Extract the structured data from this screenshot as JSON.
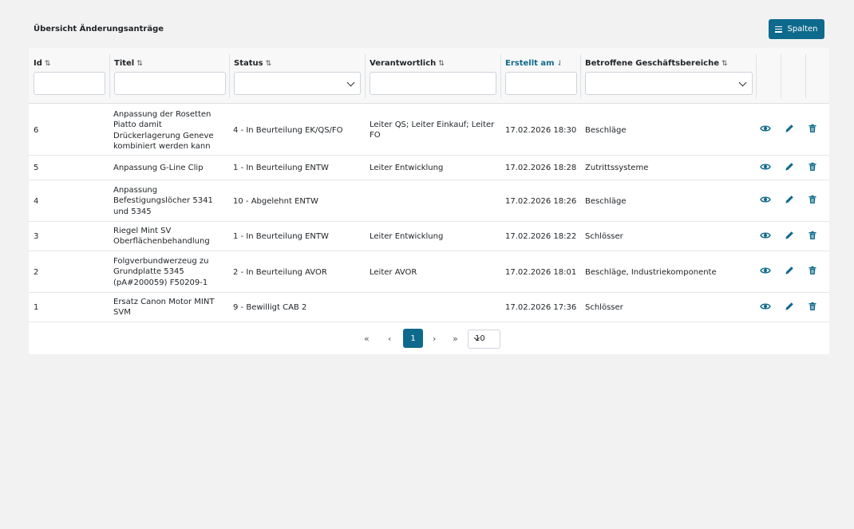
{
  "page": {
    "title": "Übersicht Änderungsanträge"
  },
  "toolbar": {
    "columns_label": "Spalten",
    "columns_icon": "menu-bars-icon"
  },
  "colors": {
    "accent": "#0e6a8c",
    "background": "#f2f2f2"
  },
  "table": {
    "headers": {
      "id": "Id",
      "titel": "Titel",
      "status": "Status",
      "verantwortlich": "Verantwortlich",
      "erstellt": "Erstellt am",
      "bereiche": "Betroffene Geschäftsbereiche"
    },
    "sort_icons": {
      "default": "⇅",
      "active": "⇃"
    },
    "sorted_column": "erstellt",
    "rows": [
      {
        "id": "6",
        "titel": "Anpassung der Rosetten Piatto damit Drückerlagerung Geneve kombiniert werden kann",
        "status": "4 - In Beurteilung EK/QS/FO",
        "verantwortlich": "Leiter QS; Leiter Einkauf; Leiter FO",
        "erstellt": "17.02.2026 18:30",
        "bereiche": "Beschläge"
      },
      {
        "id": "5",
        "titel": "Anpassung G-Line Clip",
        "status": "1 - In Beurteilung ENTW",
        "verantwortlich": "Leiter Entwicklung",
        "erstellt": "17.02.2026 18:28",
        "bereiche": "Zutrittssysteme"
      },
      {
        "id": "4",
        "titel": "Anpassung Befestigungslöcher 5341 und 5345",
        "status": "10 - Abgelehnt ENTW",
        "verantwortlich": "",
        "erstellt": "17.02.2026 18:26",
        "bereiche": "Beschläge"
      },
      {
        "id": "3",
        "titel": "Riegel Mint SV Oberflächenbehandlung",
        "status": "1 - In Beurteilung ENTW",
        "verantwortlich": "Leiter Entwicklung",
        "erstellt": "17.02.2026 18:22",
        "bereiche": "Schlösser"
      },
      {
        "id": "2",
        "titel": "Folgverbundwerzeug zu Grundplatte 5345 (pA#200059) F50209-1",
        "status": "2 - In Beurteilung AVOR",
        "verantwortlich": "Leiter AVOR",
        "erstellt": "17.02.2026 18:01",
        "bereiche": "Beschläge, Industriekomponente"
      },
      {
        "id": "1",
        "titel": "Ersatz Canon Motor MINT SVM",
        "status": "9 - Bewilligt CAB 2",
        "verantwortlich": "",
        "erstellt": "17.02.2026 17:36",
        "bereiche": "Schlösser"
      }
    ],
    "row_actions": [
      "eye-icon",
      "pencil-icon",
      "trash-icon"
    ]
  },
  "pagination": {
    "first": "«",
    "prev": "‹",
    "current_page": "1",
    "next": "›",
    "last": "»",
    "page_size": "10"
  }
}
